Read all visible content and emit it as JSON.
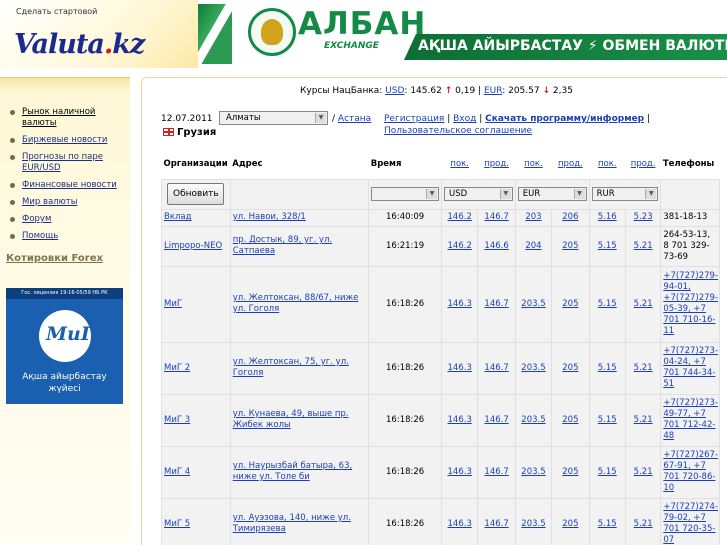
{
  "header": {
    "start_link": "Сделать стартовой",
    "logo_main": "Valuta",
    "logo_dot": ".",
    "logo_tld": "kz",
    "banner_name": "АЛБАН",
    "banner_sub": "EXCHANGE",
    "banner_slogan": "АҚША АЙЫРБАСТАУ ⚡ ОБМЕН ВАЛЮТЫ"
  },
  "sidebar": {
    "items": [
      {
        "label": "Рынок наличной валюты",
        "active": true
      },
      {
        "label": "Биржевые новости"
      },
      {
        "label": "Прогнозы по паре EUR/USD"
      },
      {
        "label": "Финансовые новости"
      },
      {
        "label": "Мир валюты"
      },
      {
        "label": "Форум"
      },
      {
        "label": "Помощь"
      }
    ],
    "forex": "Котировки Forex",
    "ad": {
      "license": "Гос. лицензия 19-16-05/59 НБ РК",
      "brand": "МиГ",
      "line1": "Ақша айырбастау",
      "line2": "жүйесі"
    }
  },
  "rates": {
    "prefix": "Курсы НацБанка:",
    "usd_label": "USD",
    "usd_value": "145.62",
    "usd_arrow": "↑",
    "usd_change": "0,19",
    "eur_label": "EUR",
    "eur_value": "205.57",
    "eur_arrow": "↓",
    "eur_change": "2,35"
  },
  "controls": {
    "date": "12.07.2011",
    "city": "Алматы",
    "separator": "/",
    "astana": "Астана",
    "country": "Грузия",
    "link_register": "Регистрация",
    "link_login": "Вход",
    "link_download": "Скачать программу/информер",
    "link_agreement": "Пользовательское соглашение",
    "refresh": "Обновить",
    "currency1": "USD",
    "currency2": "EUR",
    "currency3": "RUR"
  },
  "table": {
    "headers": {
      "org": "Организации",
      "address": "Адрес",
      "time": "Время",
      "buy": "пок.",
      "sell": "прод.",
      "phones": "Телефоны"
    },
    "rows": [
      {
        "org": "Вклад",
        "address": "ул. Навои, 328/1",
        "time": "16:40:09",
        "usd_buy": "146.2",
        "usd_sell": "146.7",
        "eur_buy": "203",
        "eur_sell": "206",
        "rur_buy": "5.16",
        "rur_sell": "5.23",
        "phone": "381-18-13"
      },
      {
        "org": "Limpopo-NEO",
        "address": "пр. Достык, 89, уг. ул. Сатпаева",
        "time": "16:21:19",
        "usd_buy": "146.2",
        "usd_sell": "146.6",
        "eur_buy": "204",
        "eur_sell": "205",
        "rur_buy": "5.15",
        "rur_sell": "5.21",
        "phone": "264-53-13, 8 701 329-73-69"
      },
      {
        "org": "МиГ",
        "address": "ул. Желтоксан, 88/67, ниже ул. Гоголя",
        "time": "16:18:26",
        "usd_buy": "146.3",
        "usd_sell": "146.7",
        "eur_buy": "203.5",
        "eur_sell": "205",
        "rur_buy": "5.15",
        "rur_sell": "5.21",
        "phone": "+7(727)279-94-01, +7(727)279-05-39, +7 701 710-16-11"
      },
      {
        "org": "МиГ 2",
        "address": "ул. Желтоксан, 75, уг. ул. Гоголя",
        "time": "16:18:26",
        "usd_buy": "146.3",
        "usd_sell": "146.7",
        "eur_buy": "203.5",
        "eur_sell": "205",
        "rur_buy": "5.15",
        "rur_sell": "5.21",
        "phone": "+7(727)273-04-24, +7 701 744-34-51"
      },
      {
        "org": "МиГ 3",
        "address": "ул. Кунаева, 49, выше пр. Жибек жолы",
        "time": "16:18:26",
        "usd_buy": "146.3",
        "usd_sell": "146.7",
        "eur_buy": "203.5",
        "eur_sell": "205",
        "rur_buy": "5.15",
        "rur_sell": "5.21",
        "phone": "+7(727)273-49-77, +7 701 712-42-48"
      },
      {
        "org": "МиГ 4",
        "address": "ул. Наурызбай батыра, 63, ниже ул. Толе би",
        "time": "16:18:26",
        "usd_buy": "146.3",
        "usd_sell": "146.7",
        "eur_buy": "203.5",
        "eur_sell": "205",
        "rur_buy": "5.15",
        "rur_sell": "5.21",
        "phone": "+7(727)267-67-91, +7 701 720-86-10"
      },
      {
        "org": "МиГ 5",
        "address": "ул. Ауэзова, 140, ниже ул. Тимирязева",
        "time": "16:18:26",
        "usd_buy": "146.3",
        "usd_sell": "146.7",
        "eur_buy": "203.5",
        "eur_sell": "205",
        "rur_buy": "5.15",
        "rur_sell": "5.21",
        "phone": "+7(727)274-79-02, +7 701 720-35-07"
      }
    ]
  }
}
